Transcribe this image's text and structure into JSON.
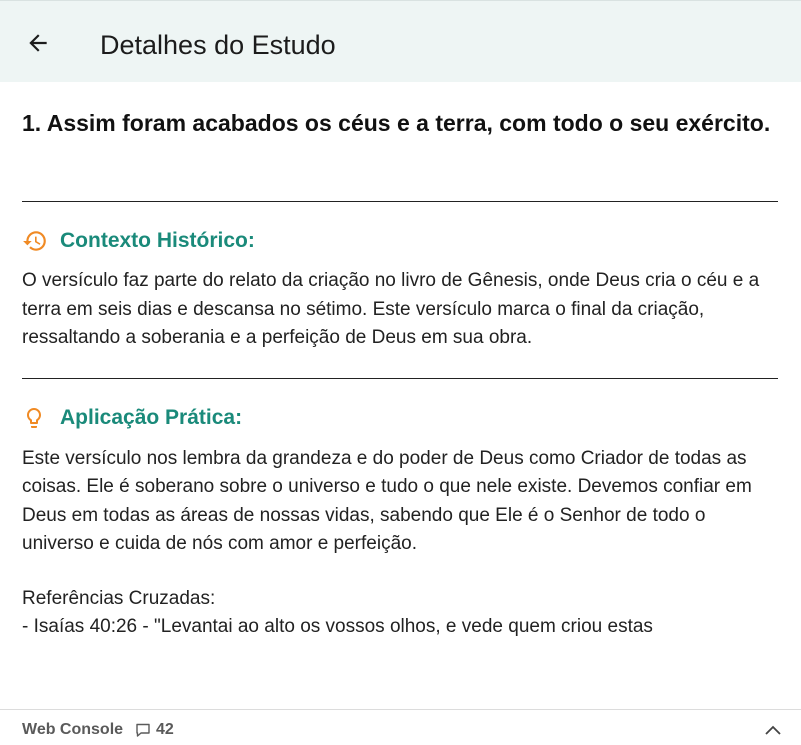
{
  "appbar": {
    "title": "Detalhes do Estudo",
    "back_icon": "arrow-left-icon"
  },
  "verse": "1. Assim foram acabados os céus e a terra, com todo o seu exército.",
  "context": {
    "icon": "history-icon",
    "icon_color": "#f08a24",
    "label": "Contexto Histórico:",
    "text": "O versículo faz parte do relato da criação no livro de Gênesis, onde Deus cria o céu e a terra em seis dias e descansa no sétimo. Este versículo marca o final da criação, ressaltando a soberania e a perfeição de Deus em sua obra."
  },
  "application": {
    "icon": "lightbulb-icon",
    "icon_color": "#f08a24",
    "label": "Aplicação Prática:",
    "text": "Este versículo nos lembra da grandeza e do poder de Deus como Criador de todas as coisas. Ele é soberano sobre o universo e tudo o que nele existe. Devemos confiar em Deus em todas as áreas de nossas vidas, sabendo que Ele é o Senhor de todo o universo e cuida de nós com amor e perfeição."
  },
  "references": {
    "label": "Referências Cruzadas:",
    "first": "- Isaías 40:26 - \"Levantai ao alto os vossos olhos, e vede quem criou estas"
  },
  "footer": {
    "label": "Web Console",
    "count": "42",
    "comment_icon": "comment-icon",
    "chevron_icon": "chevron-up-icon"
  },
  "colors": {
    "accent": "#1a8a7a",
    "appbar_bg": "#eef5f4",
    "icon_orange": "#f08a24"
  }
}
